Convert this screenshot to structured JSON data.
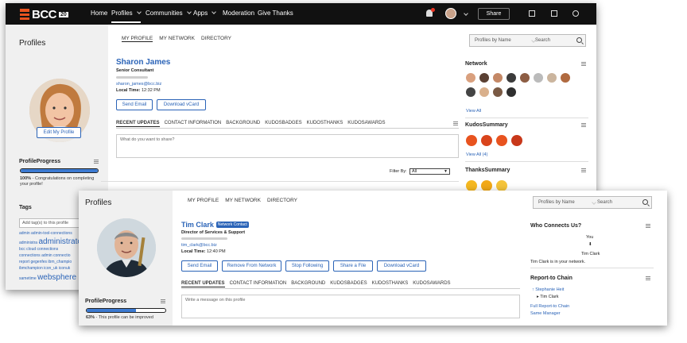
{
  "nav": {
    "brand": "BCC",
    "year": "20",
    "items": [
      "Home",
      "Profiles",
      "Communities",
      "Apps",
      "Moderation",
      "Give Thanks"
    ],
    "share_label": "Share"
  },
  "profile_a": {
    "page_title": "Profiles",
    "tabs": [
      "MY PROFILE",
      "MY NETWORK",
      "DIRECTORY"
    ],
    "name": "Sharon James",
    "job_title": "Senior Consultant",
    "email": "sharon_james@bcc.biz",
    "local_time_label": "Local Time:",
    "local_time": "12:32 PM",
    "send_email": "Send Email",
    "download_vcard": "Download vCard",
    "edit_profile": "Edit My Profile",
    "progress_title": "ProfileProgress",
    "progress_pct": 100,
    "progress_text_bold": "100%",
    "progress_text": " - Congratulations on completing your profile!",
    "tags_title": "Tags",
    "tags_placeholder": "Add tag(s) to this profile",
    "tags": [
      "admin",
      "admin-tool-connections",
      "administra",
      "administrator",
      "bcc",
      "cloud",
      "connections",
      "connections",
      "admin",
      "connectio",
      "report",
      "gegenfes",
      "ibm_champio",
      "ibmchampion",
      "icon_uk",
      "iconuk",
      "sametime",
      "websphere"
    ],
    "update_tabs": [
      "RECENT UPDATES",
      "CONTACT INFORMATION",
      "BACKGROUND",
      "KUDOSBADGES",
      "KUDOSTHANKS",
      "KUDOSAWARDS"
    ],
    "share_placeholder": "What do you want to share?",
    "filter_label": "Filter By:",
    "filter_value": "All",
    "search_scope": "Profiles by Name",
    "search_placeholder": "Search",
    "network_title": "Network",
    "view_all": "View All",
    "kudos_summary_title": "KudosSummary",
    "kudos_view_all": "View All (4)",
    "thanks_summary_title": "ThanksSummary"
  },
  "profile_b": {
    "page_title": "Profiles",
    "tabs": [
      "MY PROFILE",
      "MY NETWORK",
      "DIRECTORY"
    ],
    "name": "Tim Clark",
    "network_badge": "Network Contact",
    "job_title": "Director of Services & Support",
    "email": "tim_clark@bcc.biz",
    "local_time_label": "Local Time:",
    "local_time": "12:40 PM",
    "buttons": [
      "Send Email",
      "Remove From Network",
      "Stop Following",
      "Share a File",
      "Download vCard"
    ],
    "update_tabs": [
      "RECENT UPDATES",
      "CONTACT INFORMATION",
      "BACKGROUND",
      "KUDOSBADGES",
      "KUDOSTHANKS",
      "KUDOSAWARDS"
    ],
    "share_placeholder": "Write a message on this profile",
    "progress_title": "ProfileProgress",
    "progress_pct": 63,
    "progress_text_bold": "63%",
    "progress_text": " - This profile can be improved",
    "search_scope": "Profiles by Name",
    "search_placeholder": "Search",
    "who_connects_title": "Who Connects Us?",
    "you": "You",
    "connect_name": "Tim Clark",
    "connect_text": "Tim Clark is in your network.",
    "report_chain_title": "Report-to Chain",
    "chain_manager": "Stephanie Heit",
    "chain_person": "Tim Clark",
    "full_chain": "Full Report-to Chain",
    "same_manager": "Same Manager"
  },
  "colors": {
    "accent": "#2a63b7",
    "nav_bg": "#111111",
    "brand_orange": "#e8531f",
    "progress": "#3c7ad1"
  }
}
